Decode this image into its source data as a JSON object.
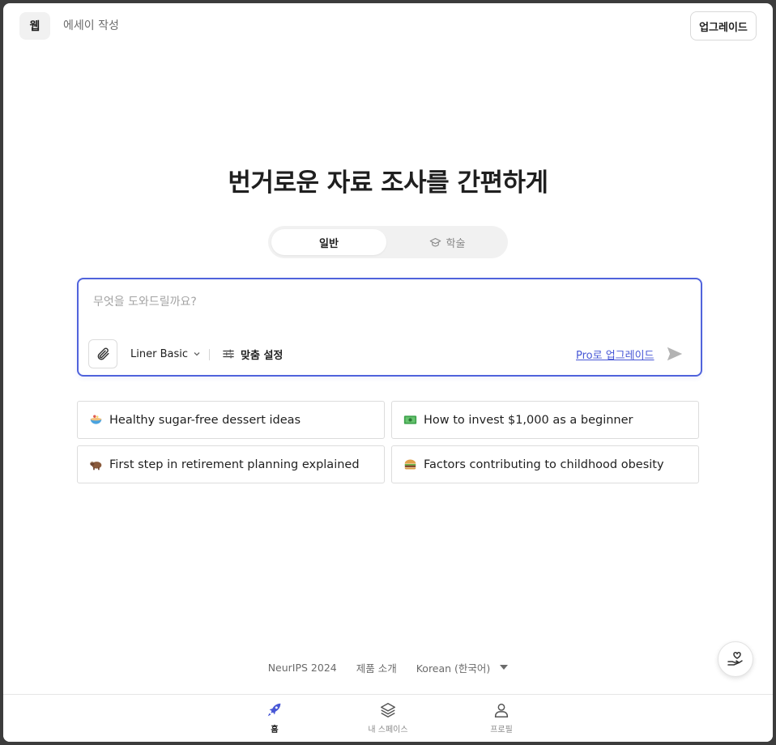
{
  "topbar": {
    "mode_active": "웹",
    "mode_inactive": "에세이 작성",
    "upgrade_label": "업그레이드"
  },
  "headline": "번거로운 자료 조사를 간편하게",
  "tabs": [
    {
      "label": "일반",
      "active": true
    },
    {
      "label": "학술",
      "active": false,
      "icon": "graduation-cap-icon"
    }
  ],
  "prompt": {
    "placeholder": "무엇을 도와드릴까요?",
    "value": "",
    "model_label": "Liner Basic",
    "custom_settings_label": "맞춤 설정",
    "pro_link_label": "Pro로 업그레이드"
  },
  "suggestions": [
    {
      "icon": "bowl-icon",
      "text": "Healthy sugar-free dessert ideas"
    },
    {
      "icon": "money-icon",
      "text": "How to invest $1,000 as a beginner"
    },
    {
      "icon": "bull-icon",
      "text": "First step in retirement planning explained"
    },
    {
      "icon": "burger-icon",
      "text": "Factors contributing to childhood obesity"
    }
  ],
  "footer": {
    "link1": "NeurIPS 2024",
    "link2": "제품 소개",
    "language": "Korean (한국어)"
  },
  "bottom_nav": [
    {
      "label": "홈",
      "icon": "rocket-icon",
      "active": true
    },
    {
      "label": "내 스페이스",
      "icon": "layers-icon",
      "active": false
    },
    {
      "label": "프로필",
      "icon": "person-icon",
      "active": false
    }
  ],
  "colors": {
    "accent": "#5063dc",
    "link": "#4757d6"
  }
}
